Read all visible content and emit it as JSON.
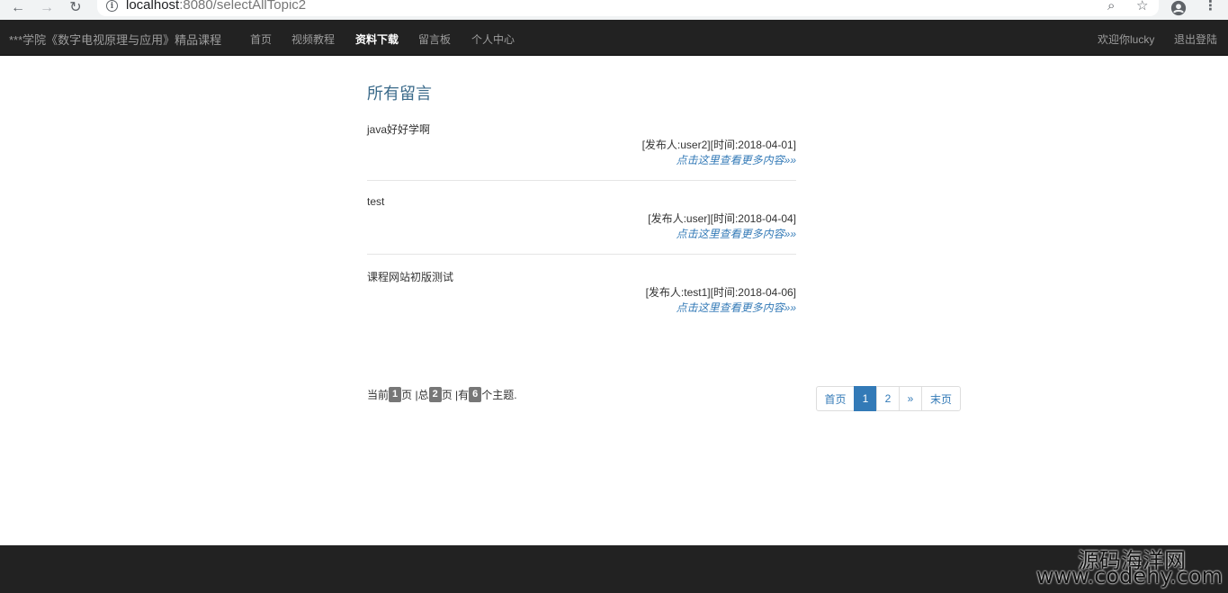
{
  "browser": {
    "url_host": "localhost",
    "url_rest": ":8080/selectAllTopic2",
    "back_icon": "←",
    "forward_icon": "→",
    "reload_icon": "↻",
    "info_icon": "i",
    "zoom_icon": "⌕",
    "star_icon": "☆",
    "menu_icon": "⋮"
  },
  "navbar": {
    "brand": "***学院《数字电视原理与应用》精品课程",
    "items": [
      {
        "label": "首页"
      },
      {
        "label": "视频教程"
      },
      {
        "label": "资料下载"
      },
      {
        "label": "留言板"
      },
      {
        "label": "个人中心"
      }
    ],
    "welcome": "欢迎你lucky",
    "logout": "退出登陆"
  },
  "main": {
    "title": "所有留言",
    "topics": [
      {
        "title": "java好好学啊",
        "meta": "[发布人:user2][时间:2018-04-01]",
        "link": "点击这里查看更多内容»»"
      },
      {
        "title": "test",
        "meta": "[发布人:user][时间:2018-04-04]",
        "link": "点击这里查看更多内容»»"
      },
      {
        "title": "课程网站初版测试",
        "meta": "[发布人:test1][时间:2018-04-06]",
        "link": "点击这里查看更多内容»»"
      }
    ],
    "page_info": {
      "prefix": "当前",
      "current": "1",
      "mid1": "页 |总",
      "total_pages": "2",
      "mid2": "页 |有",
      "total_topics": "6",
      "suffix": "个主题."
    },
    "pagination": {
      "first": "首页",
      "page1": "1",
      "page2": "2",
      "next": "»",
      "last": "末页"
    }
  },
  "watermark": {
    "line1": "源码海洋网",
    "line2": "www.codehy.com"
  }
}
